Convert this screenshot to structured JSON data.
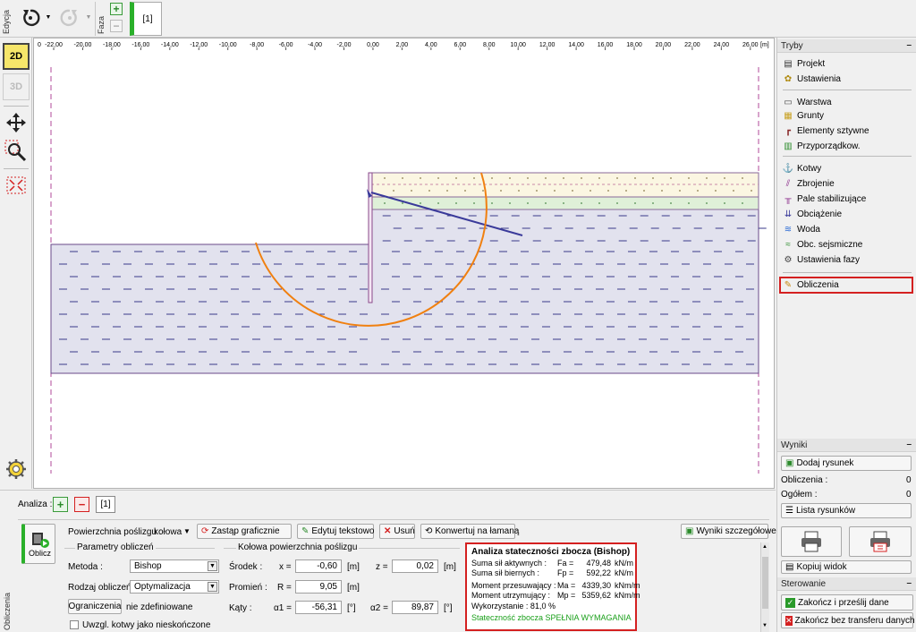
{
  "toolbar": {
    "edycja_label": "Edycja",
    "faza_label": "Faza",
    "phase_tab": "[1]"
  },
  "left_tools": {
    "view2d": "2D",
    "view3d": "3D"
  },
  "ruler": {
    "ticks": [
      "-22,00",
      "-20,00",
      "-18,00",
      "-16,00",
      "-14,00",
      "-12,00",
      "-10,00",
      "-8,00",
      "-6,00",
      "-4,00",
      "-2,00",
      "0,00",
      "2,00",
      "4,00",
      "6,00",
      "8,00",
      "10,00",
      "12,00",
      "14,00",
      "16,00",
      "18,00",
      "20,00",
      "22,00",
      "24,00",
      "26,00"
    ],
    "zero": "0",
    "unit": "[m]"
  },
  "tryby": {
    "title": "Tryby",
    "minimize": "–",
    "items": [
      {
        "label": "Projekt",
        "icon": "document-icon"
      },
      {
        "label": "Ustawienia",
        "icon": "gear-icon"
      },
      {
        "label": "Warstwa",
        "icon": "layer-icon"
      },
      {
        "label": "Grunty",
        "icon": "soil-icon"
      },
      {
        "label": "Elementy sztywne",
        "icon": "rigid-element-icon"
      },
      {
        "label": "Przyporządkow.",
        "icon": "assign-icon"
      },
      {
        "label": "Kotwy",
        "icon": "anchor-icon"
      },
      {
        "label": "Zbrojenie",
        "icon": "reinforcement-icon"
      },
      {
        "label": "Pale stabilizujące",
        "icon": "pile-icon"
      },
      {
        "label": "Obciążenie",
        "icon": "load-icon"
      },
      {
        "label": "Woda",
        "icon": "water-icon"
      },
      {
        "label": "Obc. sejsmiczne",
        "icon": "seismic-icon"
      },
      {
        "label": "Ustawienia fazy",
        "icon": "phase-settings-icon"
      },
      {
        "label": "Obliczenia",
        "icon": "calculation-icon"
      }
    ]
  },
  "wyniki": {
    "title": "Wyniki",
    "minimize": "–",
    "add_drawing": "Dodaj rysunek",
    "calc_label": "Obliczenia :",
    "calc_count": "0",
    "total_label": "Ogółem :",
    "total_count": "0",
    "drawings_list": "Lista rysunków",
    "copy_view": "Kopiuj widok"
  },
  "sterowanie": {
    "title": "Sterowanie",
    "minimize": "–",
    "finish_transfer": "Zakończ i prześlij dane",
    "finish_no_transfer": "Zakończ bez transferu danych"
  },
  "bottom": {
    "side_label": "Obliczenia",
    "analiza_label": "Analiza :",
    "analysis_tab": "[1]",
    "calc_button": "Oblicz",
    "surface_label": "Powierzchnia poślizgu :",
    "surface_value": "kołowa",
    "replace_graphic": "Zastąp graficznie",
    "edit_text": "Edytuj tekstowo",
    "delete": "Usuń",
    "convert": "Konwertuj na łamaną",
    "detailed_results": "Wyniki szczegółowe",
    "params_title": "Parametry obliczeń",
    "method_label": "Metoda :",
    "method_value": "Bishop",
    "calc_type_label": "Rodzaj obliczeń :",
    "calc_type_value": "Optymalizacja",
    "constraints_button": "Ograniczenia",
    "constraints_value": "nie zdefiniowane",
    "anchors_checkbox": "Uwzgl. kotwy jako nieskończone",
    "circle_title": "Kołowa powierzchnia poślizgu",
    "center_label": "Środek :",
    "x_label": "x =",
    "x_value": "-0,60",
    "x_unit": "[m]",
    "z_label": "z =",
    "z_value": "0,02",
    "z_unit": "[m]",
    "radius_label": "Promień :",
    "r_label": "R =",
    "r_value": "9,05",
    "r_unit": "[m]",
    "angles_label": "Kąty :",
    "a1_label": "α1 =",
    "a1_value": "-56,31",
    "a1_unit": "[°]",
    "a2_label": "α2 =",
    "a2_value": "89,87",
    "a2_unit": "[°]"
  },
  "results": {
    "title": "Analiza stateczności zbocza (Bishop)",
    "rows": [
      {
        "label": "Suma sił aktywnych :",
        "sym": "Fa =",
        "value": "479,48",
        "unit": "kN/m"
      },
      {
        "label": "Suma sił biernych :",
        "sym": "Fp =",
        "value": "592,22",
        "unit": "kN/m"
      },
      {
        "label": "Moment przesuwający :",
        "sym": "Ma =",
        "value": "4339,30",
        "unit": "kNm/m"
      },
      {
        "label": "Moment utrzymujący :",
        "sym": "Mp =",
        "value": "5359,62",
        "unit": "kNm/m"
      }
    ],
    "usage": "Wykorzystanie : 81,0  %",
    "verdict": "Stateczność zbocza SPEŁNIA WYMAGANIA",
    "verdict_color": "#1aa01a"
  },
  "colors": {
    "highlight": "#d42020",
    "slip_circle": "#f08010",
    "soil_fill": "#e2e2ee",
    "soil_dash": "#3a3a8a",
    "anchor": "#3a3a9a"
  }
}
